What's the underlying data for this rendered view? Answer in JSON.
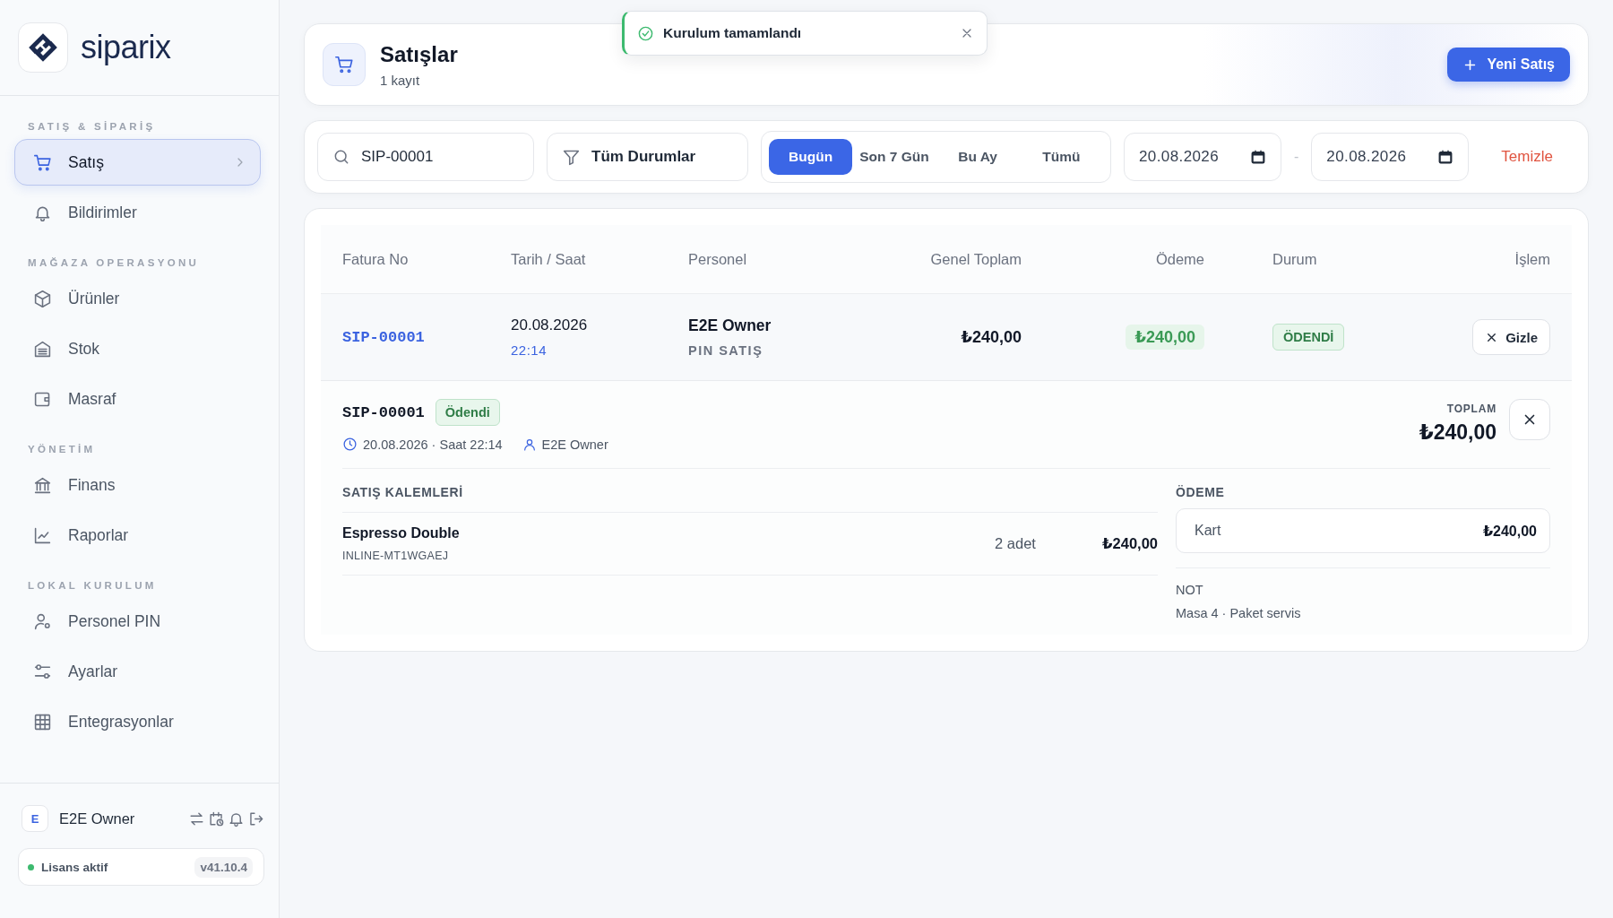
{
  "brand": {
    "name": "siparix"
  },
  "sidebar": {
    "sections": [
      {
        "title": "SATIŞ & SİPARİŞ",
        "items": [
          {
            "label": "Satış",
            "selected": true
          },
          {
            "label": "Bildirimler",
            "selected": false
          }
        ]
      },
      {
        "title": "MAĞAZA OPERASYONU",
        "items": [
          {
            "label": "Ürünler",
            "selected": false
          },
          {
            "label": "Stok",
            "selected": false
          },
          {
            "label": "Masraf",
            "selected": false
          }
        ]
      },
      {
        "title": "YÖNETİM",
        "items": [
          {
            "label": "Finans",
            "selected": false
          },
          {
            "label": "Raporlar",
            "selected": false
          }
        ]
      },
      {
        "title": "LOKAL KURULUM",
        "items": [
          {
            "label": "Personel PIN",
            "selected": false
          },
          {
            "label": "Ayarlar",
            "selected": false
          },
          {
            "label": "Entegrasyonlar",
            "selected": false
          }
        ]
      }
    ],
    "user": {
      "initial": "E",
      "name": "E2E Owner"
    },
    "license": {
      "label": "Lisans aktif",
      "version": "v41.10.4",
      "color": "#3dba6f"
    }
  },
  "toast": {
    "message": "Kurulum tamamlandı"
  },
  "page_header": {
    "title": "Satışlar",
    "count": "1 kayıt",
    "new_button": "Yeni Satış"
  },
  "filters": {
    "search": {
      "value": "SIP-00001"
    },
    "status": {
      "value": "Tüm Durumlar"
    },
    "ranges": [
      {
        "label": "Bugün",
        "selected": true
      },
      {
        "label": "Son 7 Gün",
        "selected": false
      },
      {
        "label": "Bu Ay",
        "selected": false
      },
      {
        "label": "Tümü",
        "selected": false
      }
    ],
    "date_from": "20.08.2026",
    "separator": "-",
    "date_to": "20.08.2026",
    "clear": "Temizle"
  },
  "table": {
    "columns": [
      "Fatura No",
      "Tarih / Saat",
      "Personel",
      "Genel Toplam",
      "Ödeme",
      "Durum",
      "İşlem"
    ],
    "rows": [
      {
        "invoice": "SIP-00001",
        "date": "20.08.2026",
        "time": "22:14",
        "staff": "E2E Owner",
        "channel": "PIN SATIŞ",
        "total": "₺240,00",
        "payment": "₺240,00",
        "status": "ÖDENDİ",
        "action": "Gizle",
        "expanded": true,
        "detail": {
          "invoice": "SIP-00001",
          "status": "Ödendi",
          "datetime": "20.08.2026 · Saat 22:14",
          "staff": "E2E Owner",
          "total_label": "TOPLAM",
          "total": "₺240,00",
          "items_title": "SATIŞ KALEMLERİ",
          "items": [
            {
              "name": "Espresso Double",
              "code": "INLINE-MT1WGAEJ",
              "qty": "2 adet",
              "amount": "₺240,00"
            }
          ],
          "payment_title": "ÖDEME",
          "payments": [
            {
              "method": "Kart",
              "amount": "₺240,00"
            }
          ],
          "note_title": "NOT",
          "note": "Masa 4 · Paket servis"
        }
      }
    ]
  }
}
